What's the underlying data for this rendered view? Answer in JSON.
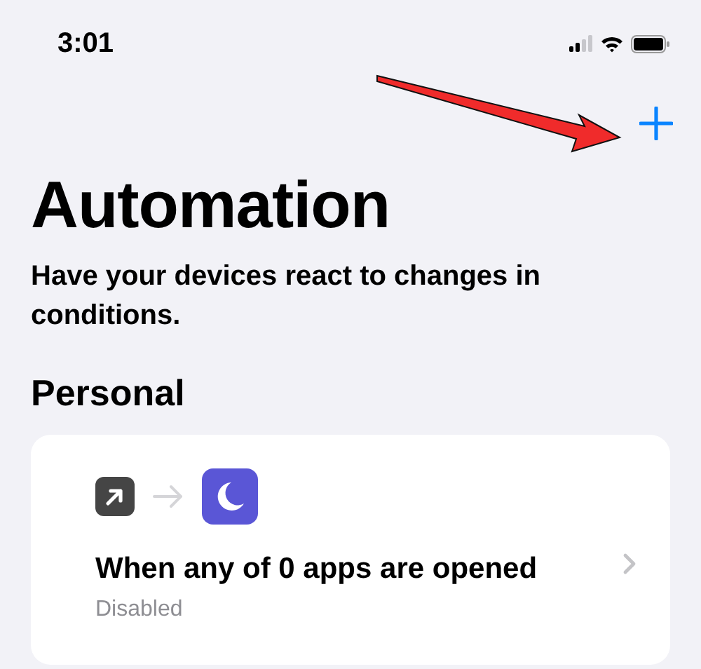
{
  "status_bar": {
    "time": "3:01"
  },
  "title": "Automation",
  "subtitle": "Have your devices react to changes in conditions.",
  "section": "Personal",
  "automations": [
    {
      "title": "When any of 0 apps are opened",
      "status": "Disabled"
    }
  ]
}
